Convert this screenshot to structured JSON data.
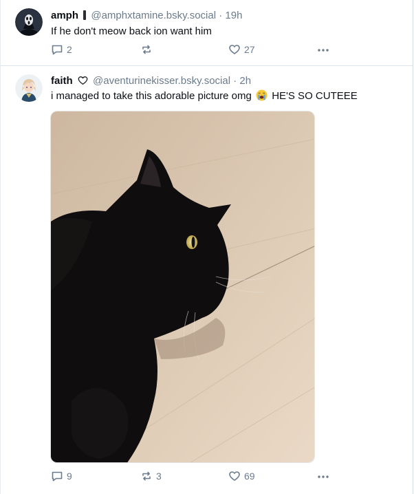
{
  "posts": [
    {
      "name": "amph",
      "handle": "@amphxtamine.bsky.social",
      "separator": "·",
      "time": "19h",
      "text": "If he don't meow back ion want him",
      "replies": "2",
      "reposts": "",
      "likes": "27"
    },
    {
      "name": "faith",
      "handle": "@aventurinekisser.bsky.social",
      "separator": "·",
      "time": "2h",
      "text_before": "i managed to take this adorable picture omg",
      "text_after": "HE'S SO CUTEEE",
      "replies": "9",
      "reposts": "3",
      "likes": "69"
    }
  ],
  "icons": {
    "reply": "speech-bubble-icon",
    "repost": "repost-arrows-icon",
    "like": "heart-icon",
    "more": "ellipsis-icon",
    "emoji": "crying-face-emoji"
  },
  "colors": {
    "muted": "#6b7b8c",
    "text": "#0b0f14",
    "divider": "#dce3ea"
  }
}
